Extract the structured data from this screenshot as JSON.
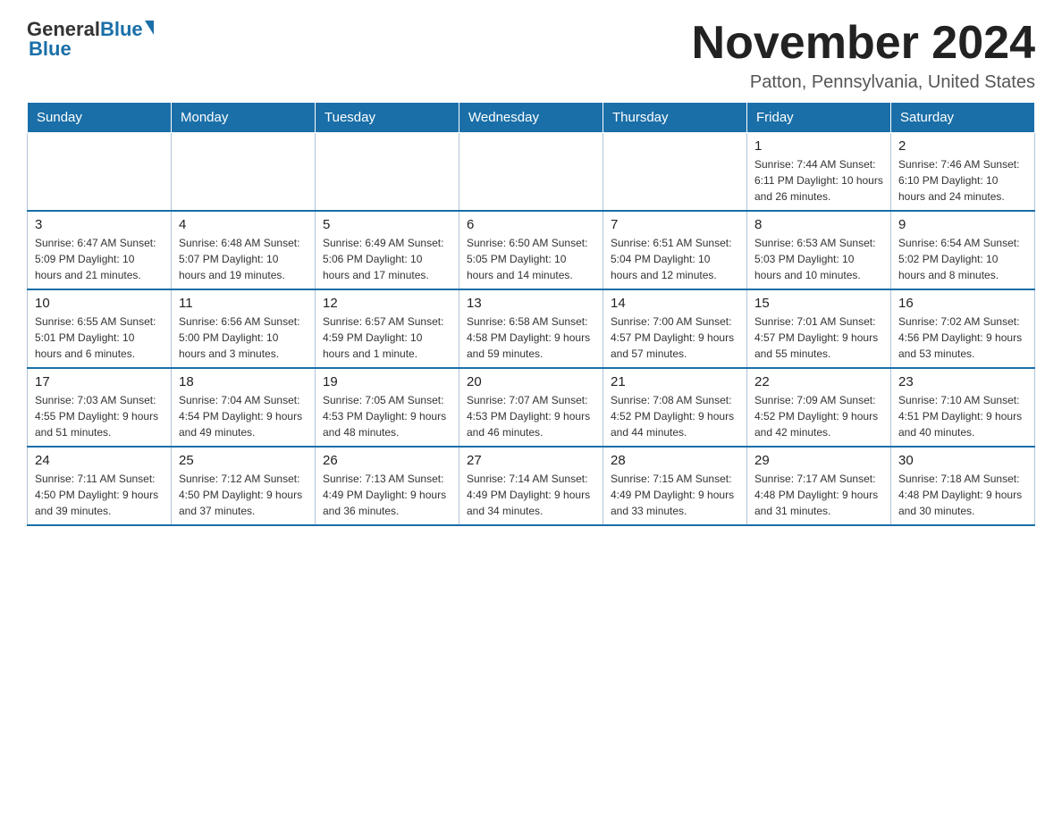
{
  "header": {
    "logo_text_general": "General",
    "logo_text_blue": "Blue",
    "month_title": "November 2024",
    "location": "Patton, Pennsylvania, United States"
  },
  "weekdays": [
    "Sunday",
    "Monday",
    "Tuesday",
    "Wednesday",
    "Thursday",
    "Friday",
    "Saturday"
  ],
  "weeks": [
    [
      {
        "day": "",
        "info": ""
      },
      {
        "day": "",
        "info": ""
      },
      {
        "day": "",
        "info": ""
      },
      {
        "day": "",
        "info": ""
      },
      {
        "day": "",
        "info": ""
      },
      {
        "day": "1",
        "info": "Sunrise: 7:44 AM\nSunset: 6:11 PM\nDaylight: 10 hours and 26 minutes."
      },
      {
        "day": "2",
        "info": "Sunrise: 7:46 AM\nSunset: 6:10 PM\nDaylight: 10 hours and 24 minutes."
      }
    ],
    [
      {
        "day": "3",
        "info": "Sunrise: 6:47 AM\nSunset: 5:09 PM\nDaylight: 10 hours and 21 minutes."
      },
      {
        "day": "4",
        "info": "Sunrise: 6:48 AM\nSunset: 5:07 PM\nDaylight: 10 hours and 19 minutes."
      },
      {
        "day": "5",
        "info": "Sunrise: 6:49 AM\nSunset: 5:06 PM\nDaylight: 10 hours and 17 minutes."
      },
      {
        "day": "6",
        "info": "Sunrise: 6:50 AM\nSunset: 5:05 PM\nDaylight: 10 hours and 14 minutes."
      },
      {
        "day": "7",
        "info": "Sunrise: 6:51 AM\nSunset: 5:04 PM\nDaylight: 10 hours and 12 minutes."
      },
      {
        "day": "8",
        "info": "Sunrise: 6:53 AM\nSunset: 5:03 PM\nDaylight: 10 hours and 10 minutes."
      },
      {
        "day": "9",
        "info": "Sunrise: 6:54 AM\nSunset: 5:02 PM\nDaylight: 10 hours and 8 minutes."
      }
    ],
    [
      {
        "day": "10",
        "info": "Sunrise: 6:55 AM\nSunset: 5:01 PM\nDaylight: 10 hours and 6 minutes."
      },
      {
        "day": "11",
        "info": "Sunrise: 6:56 AM\nSunset: 5:00 PM\nDaylight: 10 hours and 3 minutes."
      },
      {
        "day": "12",
        "info": "Sunrise: 6:57 AM\nSunset: 4:59 PM\nDaylight: 10 hours and 1 minute."
      },
      {
        "day": "13",
        "info": "Sunrise: 6:58 AM\nSunset: 4:58 PM\nDaylight: 9 hours and 59 minutes."
      },
      {
        "day": "14",
        "info": "Sunrise: 7:00 AM\nSunset: 4:57 PM\nDaylight: 9 hours and 57 minutes."
      },
      {
        "day": "15",
        "info": "Sunrise: 7:01 AM\nSunset: 4:57 PM\nDaylight: 9 hours and 55 minutes."
      },
      {
        "day": "16",
        "info": "Sunrise: 7:02 AM\nSunset: 4:56 PM\nDaylight: 9 hours and 53 minutes."
      }
    ],
    [
      {
        "day": "17",
        "info": "Sunrise: 7:03 AM\nSunset: 4:55 PM\nDaylight: 9 hours and 51 minutes."
      },
      {
        "day": "18",
        "info": "Sunrise: 7:04 AM\nSunset: 4:54 PM\nDaylight: 9 hours and 49 minutes."
      },
      {
        "day": "19",
        "info": "Sunrise: 7:05 AM\nSunset: 4:53 PM\nDaylight: 9 hours and 48 minutes."
      },
      {
        "day": "20",
        "info": "Sunrise: 7:07 AM\nSunset: 4:53 PM\nDaylight: 9 hours and 46 minutes."
      },
      {
        "day": "21",
        "info": "Sunrise: 7:08 AM\nSunset: 4:52 PM\nDaylight: 9 hours and 44 minutes."
      },
      {
        "day": "22",
        "info": "Sunrise: 7:09 AM\nSunset: 4:52 PM\nDaylight: 9 hours and 42 minutes."
      },
      {
        "day": "23",
        "info": "Sunrise: 7:10 AM\nSunset: 4:51 PM\nDaylight: 9 hours and 40 minutes."
      }
    ],
    [
      {
        "day": "24",
        "info": "Sunrise: 7:11 AM\nSunset: 4:50 PM\nDaylight: 9 hours and 39 minutes."
      },
      {
        "day": "25",
        "info": "Sunrise: 7:12 AM\nSunset: 4:50 PM\nDaylight: 9 hours and 37 minutes."
      },
      {
        "day": "26",
        "info": "Sunrise: 7:13 AM\nSunset: 4:49 PM\nDaylight: 9 hours and 36 minutes."
      },
      {
        "day": "27",
        "info": "Sunrise: 7:14 AM\nSunset: 4:49 PM\nDaylight: 9 hours and 34 minutes."
      },
      {
        "day": "28",
        "info": "Sunrise: 7:15 AM\nSunset: 4:49 PM\nDaylight: 9 hours and 33 minutes."
      },
      {
        "day": "29",
        "info": "Sunrise: 7:17 AM\nSunset: 4:48 PM\nDaylight: 9 hours and 31 minutes."
      },
      {
        "day": "30",
        "info": "Sunrise: 7:18 AM\nSunset: 4:48 PM\nDaylight: 9 hours and 30 minutes."
      }
    ]
  ]
}
